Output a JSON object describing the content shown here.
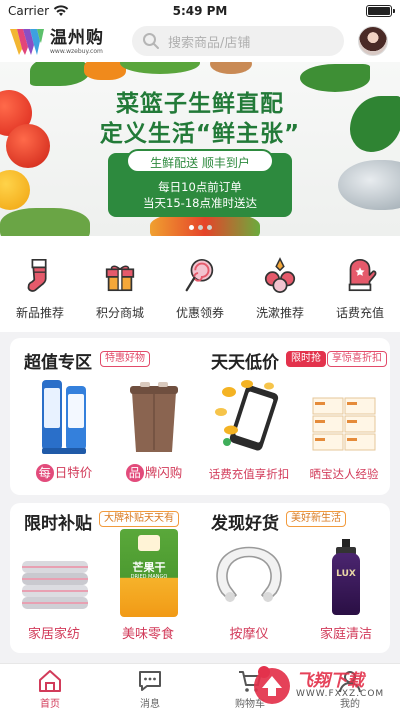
{
  "status_bar": {
    "carrier": "Carrier",
    "time": "5:49 PM"
  },
  "header": {
    "logo_text": "温州购",
    "logo_url": "www.wzebuy.com",
    "search_placeholder": "搜索商品/店铺"
  },
  "banner": {
    "title_line1": "菜篮子生鲜直配",
    "title_line2": "定义生活“鲜主张”",
    "pill_text": "生鲜配送  顺丰到户",
    "line1": "每日10点前订单",
    "line2": "当天15-18点准时送达",
    "colors": {
      "green": "#2d8a3e",
      "title_green": "#227a38"
    }
  },
  "categories": [
    {
      "label": "新品推荐",
      "icon": "stocking-icon"
    },
    {
      "label": "积分商城",
      "icon": "gift-icon"
    },
    {
      "label": "优惠领券",
      "icon": "lollipop-icon"
    },
    {
      "label": "洗漱推荐",
      "icon": "ornaments-icon"
    },
    {
      "label": "话费充值",
      "icon": "mitten-icon"
    }
  ],
  "section1": {
    "left_title": "超值专区",
    "left_tag": "特惠好物",
    "right_title": "天天低价",
    "right_tag1": "限时抢",
    "right_tag2": "享惊喜折扣",
    "items": [
      {
        "first_char": "每",
        "rest": "日特价"
      },
      {
        "first_char": "品",
        "rest": "牌闪购"
      },
      {
        "label": "话费充值享折扣"
      },
      {
        "label": "晒宝达人经验"
      }
    ]
  },
  "section2": {
    "left_title": "限时补贴",
    "left_tag": "大牌补贴天天有",
    "right_title": "发现好货",
    "right_tag": "美好新生活",
    "items": [
      {
        "label": "家居家纺"
      },
      {
        "label": "美味零食",
        "pack_text": "芒果干",
        "pack_sub": "DRIED MANGO"
      },
      {
        "label": "按摩仪"
      },
      {
        "label": "家庭清洁",
        "bottle_text": "LUX"
      }
    ]
  },
  "tabbar": [
    {
      "label": "首页",
      "icon": "home-icon",
      "active": true
    },
    {
      "label": "消息",
      "icon": "message-icon",
      "active": false
    },
    {
      "label": "购物车",
      "icon": "cart-icon",
      "active": false
    },
    {
      "label": "我的",
      "icon": "profile-icon",
      "active": false
    }
  ],
  "watermark": {
    "text": "飞翔下载",
    "url": "WWW.FXXZ.COM"
  },
  "colors": {
    "accent": "#d23b5a",
    "tag_red": "#e3324c"
  }
}
